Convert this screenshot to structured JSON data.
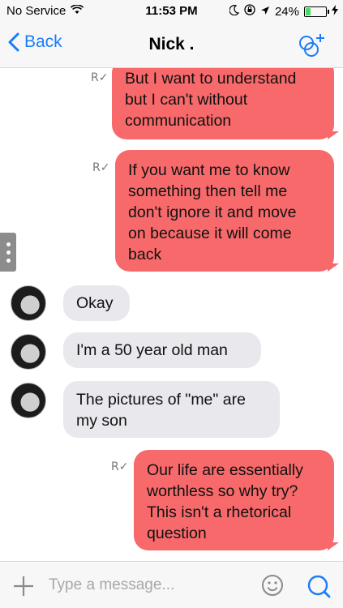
{
  "status_bar": {
    "carrier": "No Service",
    "time": "11:53 PM",
    "battery": "24%",
    "battery_level": 0.24
  },
  "nav": {
    "back_label": "Back",
    "title": "Nick ."
  },
  "messages": [
    {
      "direction": "out",
      "read_receipt": "R",
      "text": "But I want to understand\nbut I can't without\ncommunication"
    },
    {
      "direction": "out",
      "read_receipt": "R",
      "text": "If you want me to know\nsomething then tell me\ndon't ignore it and move\non because it will come\nback"
    },
    {
      "direction": "in",
      "text": "Okay"
    },
    {
      "direction": "in",
      "text": "I'm a 50 year old man"
    },
    {
      "direction": "in",
      "text": "The pictures of \"me\" are\nmy son"
    },
    {
      "direction": "out",
      "read_receipt": "R",
      "text": "Our life are essentially\nworthless so why try?\nThis isn't a rhetorical\nquestion"
    }
  ],
  "composer": {
    "placeholder": "Type a message..."
  },
  "colors": {
    "outgoing_bubble": "#f7696a",
    "incoming_bubble": "#e8e8ed",
    "accent": "#1a7cf8"
  }
}
